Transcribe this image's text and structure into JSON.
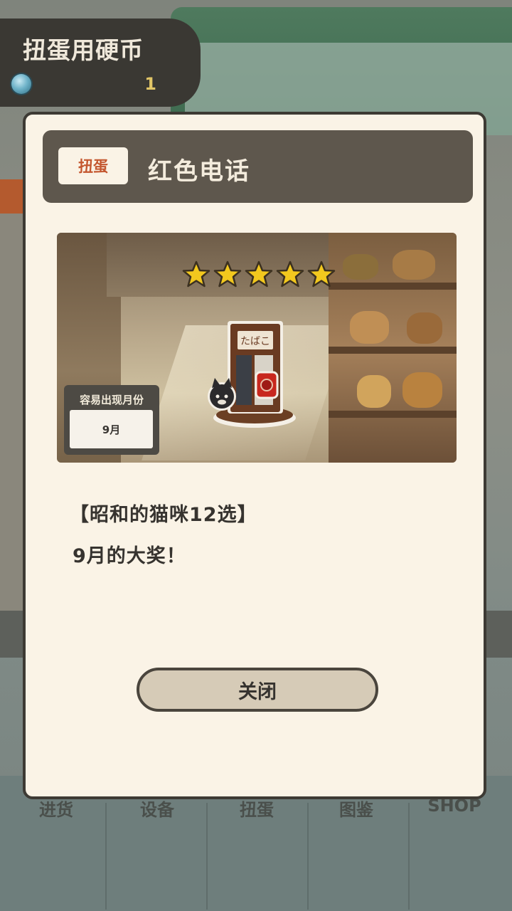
{
  "coin_panel": {
    "title": "扭蛋用硬币",
    "count": "1",
    "icon": "coin-icon"
  },
  "nav": {
    "items": [
      "进货",
      "设备",
      "扭蛋",
      "图鉴",
      "SHOP"
    ]
  },
  "dialog": {
    "badge": "扭蛋",
    "item_name": "红色电话",
    "rarity_stars": 5,
    "booth_sign": "たばこ",
    "month_label": "容易出现月份",
    "month_value": "9月",
    "description_line1": "【昭和的猫咪12选】",
    "description_line2": "9月的大奖！",
    "close_label": "关闭"
  },
  "colors": {
    "dialog_bg": "#faf3e6",
    "header_bg": "#5e574d",
    "badge_text": "#c4572f",
    "star": "#f2c81e",
    "coin_count": "#e1c567",
    "button_bg": "#d6cbb7"
  }
}
